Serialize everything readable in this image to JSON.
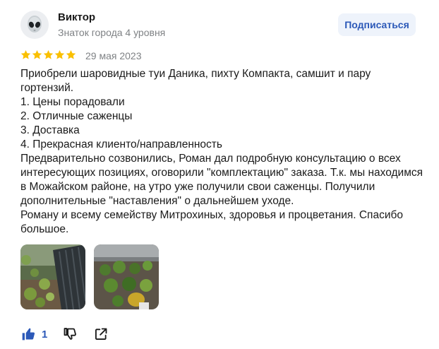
{
  "author": {
    "name": "Виктор",
    "level": "Знаток города 4 уровня",
    "avatar_icon": "alien-face-icon"
  },
  "subscribe_button": {
    "label": "Подписаться"
  },
  "rating": {
    "stars": 5,
    "max": 5,
    "star_color": "#fac000"
  },
  "review": {
    "date": "29 мая 2023",
    "text": "Приобрели шаровидные туи Даника, пихту Компакта, самшит и пару гортензий.\n1. Цены порадовали\n2. Отличные саженцы\n3. Доставка\n4. Прекрасная клиенто/направленность\nПредварительно созвонились, Роман дал подробную консультацию о всех интересующих позициях, оговорили \"комплектацию\" заказа. Т.к. мы находимся в Можайском районе, на утро уже получили свои саженцы. Получили дополнительные \"наставления\" о дальнейшем уходе.\nРоману и всему семейству Митрохиных, здоровья и процветания. Спасибо большое."
  },
  "photos": [
    {
      "icon": "photo-plants-by-fence"
    },
    {
      "icon": "photo-potted-thujas"
    }
  ],
  "actions": {
    "like_count": "1",
    "like_icon": "thumbs-up-icon",
    "dislike_icon": "thumbs-down-icon",
    "share_icon": "share-icon"
  },
  "colors": {
    "accent": "#2c59b8",
    "button_bg": "#eef3fb",
    "muted_text": "#7f8285"
  }
}
